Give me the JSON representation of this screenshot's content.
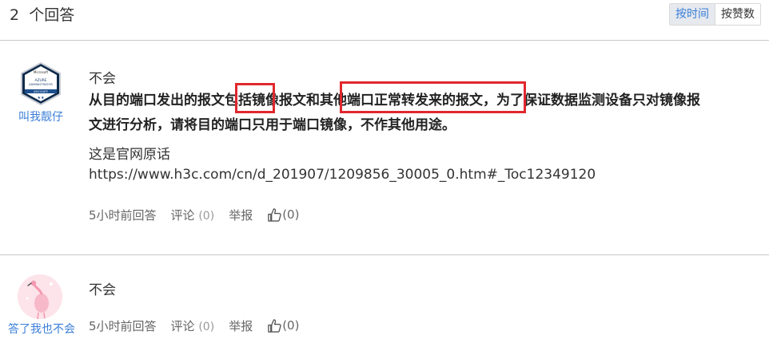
{
  "header": {
    "answer_count": "2",
    "answer_count_label": "个回答",
    "sort_by_time": "按时间",
    "sort_by_likes": "按赞数"
  },
  "answers": [
    {
      "username": "叫我靓仔",
      "avatar_icon": "azure-administrator-badge-icon",
      "badge_text": {
        "brand": "Microsoft",
        "line1": "AZURE",
        "line2": "ADMINISTRATOR",
        "line3": "ASSOCIATE"
      },
      "title": "不会",
      "bold_segments": [
        "从目的端口发出的报文",
        "包括",
        "镜像报文和",
        "其他端口正常转发来的报文",
        "，为了保证数据监测设备只对镜像报",
        "文进行分析，请将目的端口只用于端口镜像，不作其他用途。"
      ],
      "plain_text": "这是官网原话",
      "url": "https://www.h3c.com/cn/d_201907/1209856_30005_0.htm#_Toc12349120",
      "time": "5小时前回答",
      "comment_label": "评论",
      "comment_count": "(0)",
      "report_label": "举报",
      "like_count": "(0)"
    },
    {
      "username": "答了我也不会",
      "avatar_icon": "pink-flamingo-avatar-icon",
      "title": "不会",
      "time": "5小时前回答",
      "comment_label": "评论",
      "comment_count": "(0)",
      "report_label": "举报",
      "like_count": "(0)"
    }
  ],
  "colors": {
    "accent": "#3a7ed8",
    "highlight": "#e0282e",
    "divider": "#c8c8c8"
  }
}
